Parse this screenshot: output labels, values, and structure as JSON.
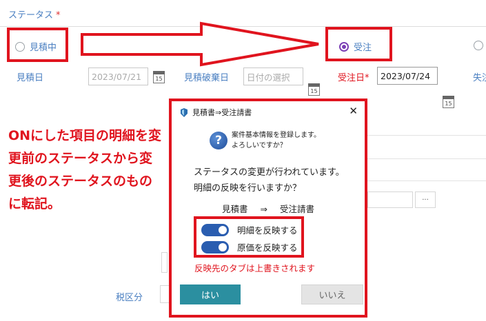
{
  "status": {
    "label": "ステータス",
    "required_mark": "*",
    "options": [
      {
        "label": "見積中",
        "selected": false
      },
      {
        "label": "受注",
        "selected": true
      }
    ]
  },
  "dates": {
    "estimate_date": {
      "label": "見積日",
      "value": "2023/07/21"
    },
    "estimate_discard_date": {
      "label": "見積破棄日",
      "placeholder": "日付の選択"
    },
    "order_date": {
      "label": "受注日",
      "required_mark": "*",
      "value": "2023/07/24"
    },
    "lost_label_partial": "失注"
  },
  "calendar_icon_text": "15",
  "background": {
    "tax_label": "税区分",
    "ellipsis": "···"
  },
  "callout_text": "ONにした項目の明細を変更前のステータスから変更後のステータスのものに転記。",
  "dialog": {
    "title": "見積書⇒受注請書",
    "close": "✕",
    "info_line1": "案件基本情報を登録します。",
    "info_line2": "よろしいですか？",
    "message_line1": "ステータスの変更が行われています。",
    "message_line2": "明細の反映を行いますか？",
    "doc_from": "見積書",
    "doc_arrow": "⇒",
    "doc_to": "受注請書",
    "toggles": [
      {
        "label": "明細を反映する",
        "on": true
      },
      {
        "label": "原価を反映する",
        "on": true
      }
    ],
    "warning": "反映先のタブは上書きされます",
    "yes_label": "はい",
    "no_label": "いいえ"
  },
  "colors": {
    "accent_blue": "#4a7fc1",
    "highlight_red": "#e0141e",
    "radio_purple": "#7b3fb5",
    "toggle_blue": "#2a5db0",
    "yes_button": "#2b8fa0"
  }
}
